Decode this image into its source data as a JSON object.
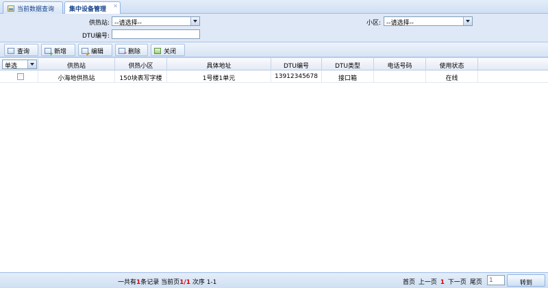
{
  "tabs": [
    {
      "label": "当前数据查询",
      "icon": "home-icon"
    },
    {
      "label": "集中设备管理",
      "close": "×"
    }
  ],
  "filter": {
    "station_label": "供热站:",
    "station_value": "--请选择--",
    "area_label": "小区:",
    "area_value": "--请选择--",
    "dtu_label": "DTU编号:",
    "dtu_value": ""
  },
  "toolbar": {
    "query": "查询",
    "add": "新增",
    "edit": "编辑",
    "delete": "删除",
    "close": "关闭"
  },
  "grid": {
    "select_mode": "单选",
    "columns": [
      "供热站",
      "供热小区",
      "具体地址",
      "DTU编号",
      "DTU类型",
      "电话号码",
      "使用状态"
    ],
    "rows": [
      {
        "station": "小海地供热站",
        "area": "150块表写字楼",
        "address": "1号楼1单元",
        "dtu_no": "13912345678",
        "dtu_type": "接口箱",
        "phone": "",
        "status": "在线"
      }
    ]
  },
  "footer": {
    "total_prefix": "一共有",
    "total_count": "1",
    "total_suffix": "条记录 当前页",
    "current_page": "1/1",
    "order": "次序 1-1",
    "first": "首页",
    "prev": "上一页",
    "page_num": "1",
    "next": "下一页",
    "last": "尾页",
    "page_input": "1",
    "go": "转到"
  },
  "colors": {
    "frame": "#d5e3f5",
    "header_text": "#15428b",
    "highlight": "#d40000"
  }
}
